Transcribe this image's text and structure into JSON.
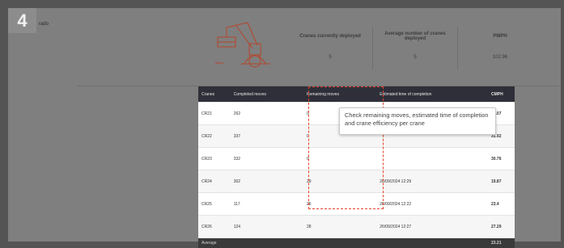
{
  "step_badge": "4",
  "top_left_label": "rado",
  "stats": {
    "headers": [
      "Cranes currently deployed",
      "Average number of cranes deployed",
      "PMPH"
    ],
    "values": [
      "5",
      "5",
      "102.96"
    ]
  },
  "crane_table": {
    "headers": [
      "Cranes",
      "Completed moves",
      "Remaining moves",
      "Estimated time of completion",
      "CMPH"
    ],
    "rows": [
      [
        "CR21",
        "262",
        "0",
        "",
        "25.07"
      ],
      [
        "CR22",
        "337",
        "0",
        "",
        "31.92"
      ],
      [
        "CR23",
        "332",
        "0",
        "",
        "30.76"
      ],
      [
        "CR24",
        "302",
        "29",
        "26/09/2024 12:29",
        "19.87"
      ],
      [
        "CR25",
        "117",
        "26",
        "26/09/2024 12:22",
        "23.4"
      ],
      [
        "CR26",
        "124",
        "28",
        "26/09/2024 12:27",
        "27.29"
      ]
    ],
    "average_label": "Average",
    "average_value": "23.21"
  },
  "callout_text": "Check remaining moves, estimated time of completion and crane efficiency per crane",
  "colors": {
    "overlay": "#7f7f7f",
    "table_header": "#2f2f39",
    "highlight": "#e0452e",
    "crane_line": "#b5452a"
  },
  "icons": {
    "illustration": "harbor-crane-illustration"
  }
}
